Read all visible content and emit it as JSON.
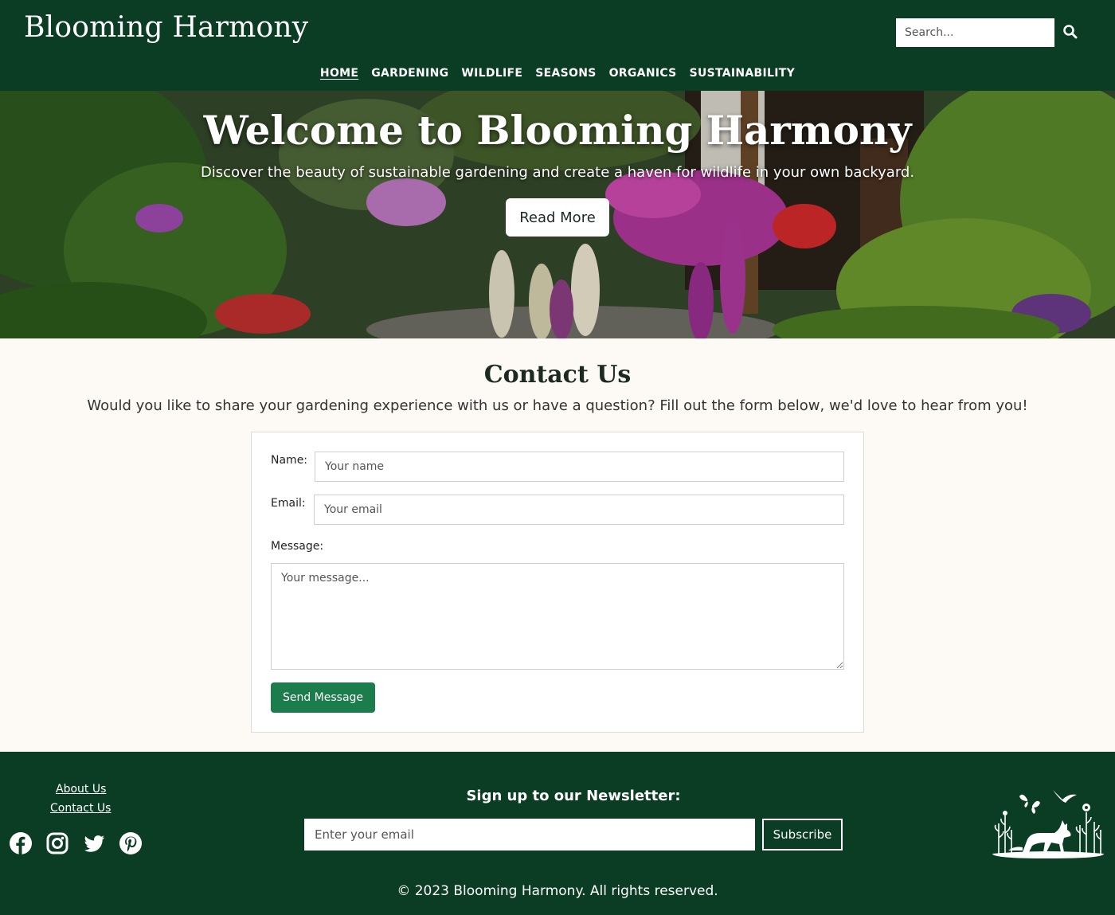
{
  "header": {
    "brand": "Blooming Harmony",
    "search_placeholder": "Search...",
    "search_icon": "search-icon",
    "nav": [
      {
        "label": "HOME",
        "active": true
      },
      {
        "label": "GARDENING"
      },
      {
        "label": "WILDLIFE"
      },
      {
        "label": "SEASONS"
      },
      {
        "label": "ORGANICS"
      },
      {
        "label": "SUSTAINABILITY"
      }
    ]
  },
  "hero": {
    "title": "Welcome to Blooming Harmony",
    "subtitle": "Discover the beauty of sustainable gardening and create a haven for wildlife in your own backyard.",
    "button_label": "Read More"
  },
  "contact": {
    "title": "Contact Us",
    "intro": "Would you like to share your gardening experience with us or have a question? Fill out the form below, we'd love to hear from you!",
    "name_label": "Name:",
    "name_placeholder": "Your name",
    "email_label": "Email:",
    "email_placeholder": "Your email",
    "message_label": "Message:",
    "message_placeholder": "Your message...",
    "send_label": "Send Message"
  },
  "footer": {
    "links": [
      "About Us",
      "Contact Us"
    ],
    "socials": [
      "facebook-icon",
      "instagram-icon",
      "twitter-icon",
      "pinterest-icon"
    ],
    "newsletter_title": "Sign up to our Newsletter:",
    "newsletter_placeholder": "Enter your email",
    "subscribe_label": "Subscribe",
    "copyright": "© 2023 Blooming Harmony. All rights reserved."
  },
  "colors": {
    "header_bg": "#0b3d24",
    "accent_button": "#1b7d4b",
    "page_bg": "#fdf9f5"
  }
}
